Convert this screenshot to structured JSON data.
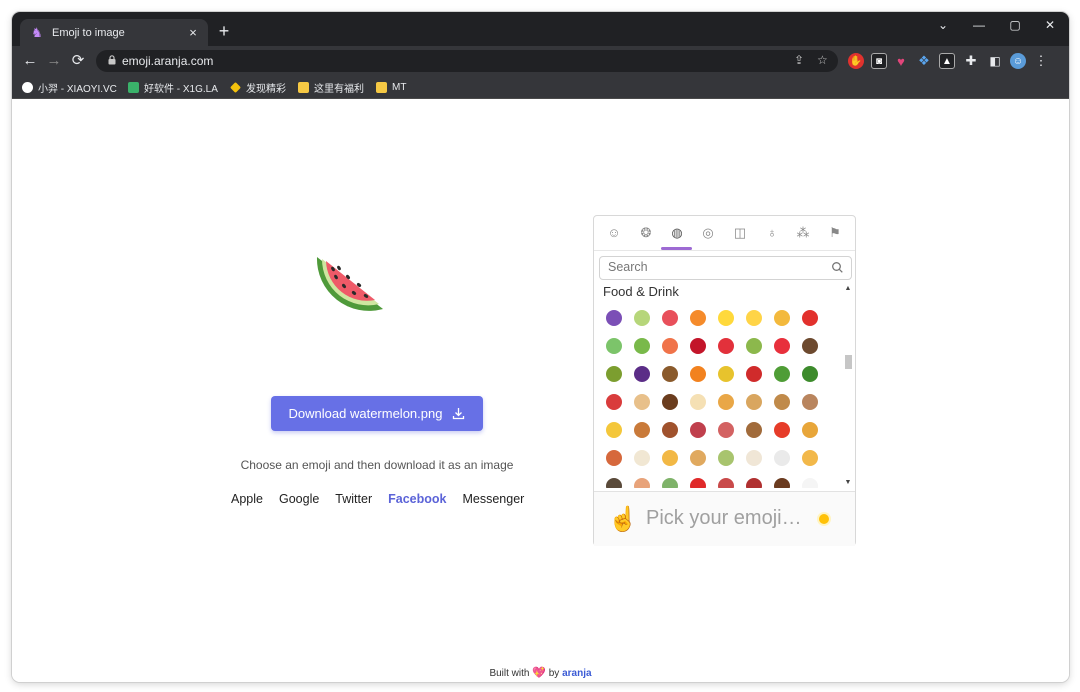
{
  "browser": {
    "tab_title": "Emoji to image",
    "tab_close": "×",
    "new_tab": "+",
    "url": "emoji.aranja.com",
    "window_controls": [
      "⌄",
      "—",
      "▢",
      "✕"
    ],
    "bookmarks": [
      {
        "label": "小羿 - XIAOYI.VC",
        "icon": "avatar-icon",
        "color": "#ffffff"
      },
      {
        "label": "好软件 - X1G.LA",
        "icon": "x1g-icon",
        "color": "#3ab26a"
      },
      {
        "label": "发现精彩",
        "icon": "sparkle-icon",
        "color": "#f4c20d"
      },
      {
        "label": "这里有福利",
        "icon": "folder-icon",
        "color": "#f6c944"
      },
      {
        "label": "MT",
        "icon": "folder-icon",
        "color": "#f6c944"
      }
    ]
  },
  "page": {
    "hero_emoji": "watermelon",
    "download_label": "Download watermelon.png",
    "subtitle": "Choose an emoji and then download it as an image",
    "vendors": [
      "Apple",
      "Google",
      "Twitter",
      "Facebook",
      "Messenger"
    ],
    "active_vendor": "Facebook",
    "footer": {
      "prefix": "Built with",
      "middle": "by",
      "brand": "aranja"
    }
  },
  "picker": {
    "categories": [
      "smileys",
      "animals",
      "food",
      "activity",
      "travel",
      "objects",
      "symbols",
      "flags"
    ],
    "active_category": "food",
    "search_placeholder": "Search",
    "section_title": "Food & Drink",
    "preview_text": "Pick your emoji…",
    "grid_colors": [
      "#7b4fb6",
      "#b6d67a",
      "#e8505b",
      "#f58b2b",
      "#ffd93b",
      "#ffd447",
      "#f3b93d",
      "#e2312d",
      "#7cc46a",
      "#79b94a",
      "#f0734a",
      "#c3152a",
      "#e2313b",
      "#8cb84c",
      "#e8303c",
      "#6d4a2f",
      "#7c9e2f",
      "#5b2d87",
      "#8a5a2c",
      "#f2821f",
      "#e7c32d",
      "#d02b2b",
      "#4f9d36",
      "#3d8b2c",
      "#d93c3c",
      "#e8c08a",
      "#6b3d1e",
      "#f5e0b4",
      "#e9a747",
      "#d9a65f",
      "#c08a4a",
      "#b9855e",
      "#f4c73b",
      "#c97a3a",
      "#a0522d",
      "#c0404d",
      "#d36262",
      "#a16b3b",
      "#e63c29",
      "#e8a63a",
      "#d6683c",
      "#f1e7d3",
      "#f2b845",
      "#e0a95f",
      "#a8c46e",
      "#f0e6d6",
      "#eaeaea",
      "#f2b84a",
      "#5a4a3a",
      "#e8a37a",
      "#7fb36a",
      "#e02a2a",
      "#c94a4a",
      "#b03030",
      "#6b3b1f",
      "#f5f5f5"
    ]
  }
}
